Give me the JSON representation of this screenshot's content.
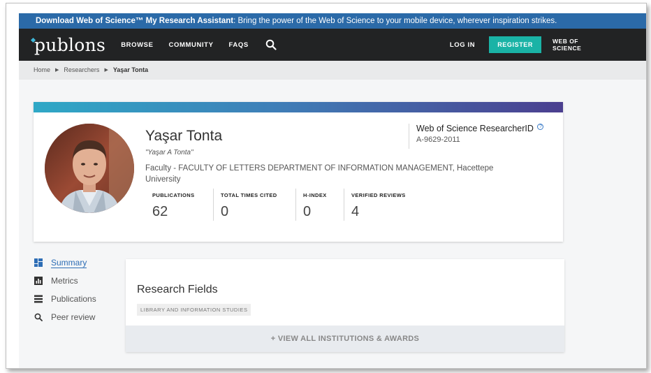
{
  "promo": {
    "bold_text": "Download Web of Science™ My Research Assistant",
    "rest_text": ": Bring the power of the Web of Science to your mobile device, wherever inspiration strikes."
  },
  "nav": {
    "logo": "publons",
    "browse": "BROWSE",
    "community": "COMMUNITY",
    "faqs": "FAQS",
    "login": "LOG IN",
    "register": "REGISTER",
    "wos_line1": "WEB OF",
    "wos_line2": "SCIENCE"
  },
  "breadcrumb": {
    "home": "Home",
    "researchers": "Researchers",
    "current": "Yaşar Tonta"
  },
  "profile": {
    "name": "Yaşar Tonta",
    "alias": "\"Yaşar A Tonta\"",
    "affiliation": "Faculty - FACULTY OF LETTERS DEPARTMENT OF INFORMATION MANAGEMENT, Hacettepe University",
    "researcher_id_label": "Web of Science ResearcherID",
    "researcher_id": "A-9629-2011",
    "help_symbol": "?"
  },
  "metrics": [
    {
      "label": "PUBLICATIONS",
      "value": "62"
    },
    {
      "label": "TOTAL TIMES CITED",
      "value": "0"
    },
    {
      "label": "H-INDEX",
      "value": "0"
    },
    {
      "label": "VERIFIED REVIEWS",
      "value": "4"
    }
  ],
  "sidebar": {
    "items": [
      {
        "label": "Summary",
        "icon": "summary-grid-icon"
      },
      {
        "label": "Metrics",
        "icon": "bar-chart-icon"
      },
      {
        "label": "Publications",
        "icon": "list-icon"
      },
      {
        "label": "Peer review",
        "icon": "search-icon"
      }
    ]
  },
  "research_fields": {
    "title": "Research Fields",
    "tags": [
      "LIBRARY AND INFORMATION STUDIES"
    ],
    "view_all": "+ VIEW ALL INSTITUTIONS & AWARDS"
  },
  "colors": {
    "promo_bg": "#2b6aa8",
    "nav_bg": "#222324",
    "register_bg": "#1ab3a6",
    "link_active": "#2d6db5"
  }
}
